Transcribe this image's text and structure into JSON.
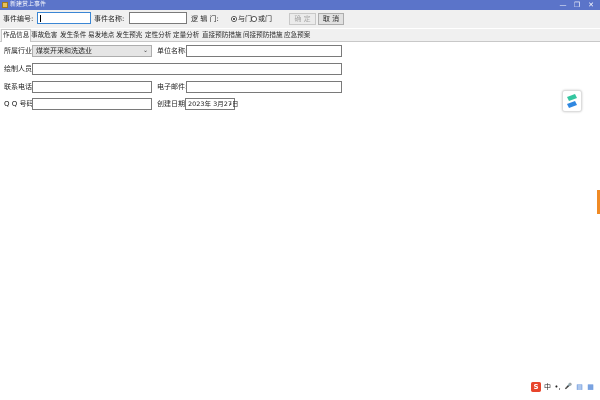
{
  "window": {
    "title": "新建赏上事件",
    "min_glyph": "—",
    "max_glyph": "❐",
    "close_glyph": "✕"
  },
  "toolbar": {
    "event_no_label": "事件编号:",
    "event_no_value": "",
    "event_name_label": "事件名称:",
    "event_name_value": "",
    "logic_gate_label": "逻 辑 门:",
    "and_gate_label": "与门",
    "or_gate_label": "或门",
    "selected_gate": "与门",
    "ok_label": "确 定",
    "cancel_label": "取 消"
  },
  "tabs": [
    {
      "label": "作品信息",
      "active": true
    },
    {
      "label": "事故危害",
      "active": false
    },
    {
      "label": "发生条件",
      "active": false
    },
    {
      "label": "易发地点",
      "active": false
    },
    {
      "label": "发生预兆",
      "active": false
    },
    {
      "label": "定性分析",
      "active": false
    },
    {
      "label": "定量分析",
      "active": false
    },
    {
      "label": "直接预防措施",
      "active": false
    },
    {
      "label": "间接预防措施",
      "active": false
    },
    {
      "label": "应急预案",
      "active": false
    }
  ],
  "form": {
    "industry_label": "所属行业:",
    "industry_value": "煤炭开采和洗选业",
    "unit_name_label": "单位名称:",
    "unit_name_value": "",
    "drafter_label": "绘制人员:",
    "drafter_value": "",
    "phone_label": "联系电话:",
    "phone_value": "",
    "email_label": "电子邮件:",
    "email_value": "",
    "qq_label": "Q Q 号码:",
    "qq_value": "",
    "created_label": "创建日期:",
    "created_value": "2023年 3月27日"
  },
  "ime": {
    "logo": "S",
    "mode": "中",
    "punct": "•,",
    "mic": "🎤",
    "skin": "▤",
    "grid": "▦"
  },
  "colors": {
    "titlebar": "#5b74c9",
    "accent_edge": "#f08a24"
  }
}
